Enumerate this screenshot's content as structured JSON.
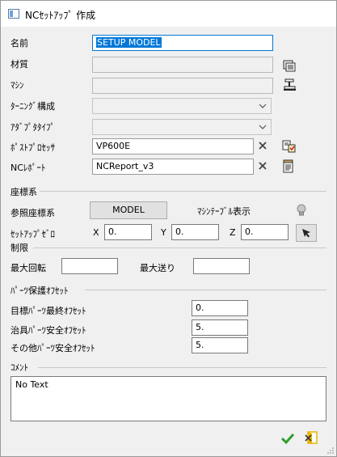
{
  "window": {
    "title": "NCｾｯﾄｱｯﾌﾟ 作成"
  },
  "form": {
    "name_label": "名前",
    "name_value": "SETUP MODEL",
    "material_label": "材質",
    "material_value": "",
    "machine_label": "ﾏｼﾝ",
    "machine_value": "",
    "turning_label": "ﾀｰﾆﾝｸﾞ構成",
    "turning_value": "",
    "adapter_label": "ｱﾀﾞﾌﾟﾀﾀｲﾌﾟ",
    "adapter_value": "",
    "post_label": "ﾎﾟｽﾄﾌﾟﾛｾｯｻ",
    "post_value": "VP600E",
    "ncreport_label": "NCﾚﾎﾟｰﾄ",
    "ncreport_value": "NCReport_v3"
  },
  "coords": {
    "section_label": "座標系",
    "ref_label": "参照座標系",
    "ref_button": "MODEL",
    "machine_table_label": "ﾏｼﾝﾃｰﾌﾞﾙ表示",
    "zero_label": "ｾｯﾄｱｯﾌﾟｾﾞﾛ",
    "x_label": "X",
    "x_value": "0.",
    "y_label": "Y",
    "y_value": "0.",
    "z_label": "Z",
    "z_value": "0."
  },
  "limits": {
    "section_label": "制限",
    "max_rot_label": "最大回転",
    "max_rot_value": "",
    "max_feed_label": "最大送り",
    "max_feed_value": ""
  },
  "offsets": {
    "section_label": "ﾊﾟｰﾂ保護ｵﾌｾｯﾄ",
    "target_label": "目標ﾊﾟｰﾂ最終ｵﾌｾｯﾄ",
    "target_value": "0.",
    "jig_label": "治具ﾊﾟｰﾂ安全ｵﾌｾｯﾄ",
    "jig_value": "5.",
    "other_label": "その他ﾊﾟｰﾂ安全ｵﾌｾｯﾄ",
    "other_value": "5."
  },
  "comment": {
    "section_label": "ｺﾒﾝﾄ",
    "value": "No Text"
  },
  "colors": {
    "ok_green": "#2e9e2e",
    "cancel_yellow": "#e8b400",
    "selection_blue": "#0078d7"
  }
}
